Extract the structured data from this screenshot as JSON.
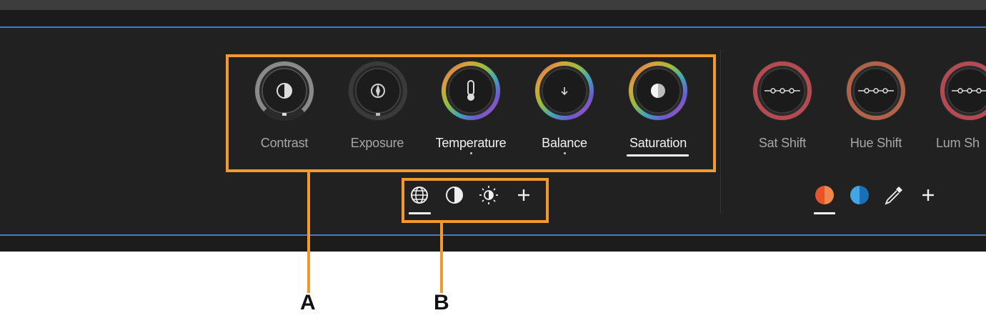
{
  "wheels": {
    "contrast": "Contrast",
    "exposure": "Exposure",
    "temperature": "Temperature",
    "balance": "Balance",
    "saturation": "Saturation"
  },
  "shift_wheels": {
    "sat_shift": "Sat Shift",
    "hue_shift": "Hue Shift",
    "lum_shift": "Lum Sh"
  },
  "global_tools": [
    "globe-icon",
    "contrast-circle-icon",
    "brightness-icon",
    "plus-icon"
  ],
  "color_tools": [
    "orange-swatch-icon",
    "blue-swatch-icon",
    "eyedropper-icon",
    "plus-icon"
  ],
  "callouts": {
    "a": "A",
    "b": "B"
  },
  "colors": {
    "accent_orange": "#f29a2e",
    "blue_rule": "#3b7fd3",
    "panel_bg": "#212121",
    "swatch_orange": "#e8542a",
    "swatch_blue": "#1d8fd8"
  }
}
